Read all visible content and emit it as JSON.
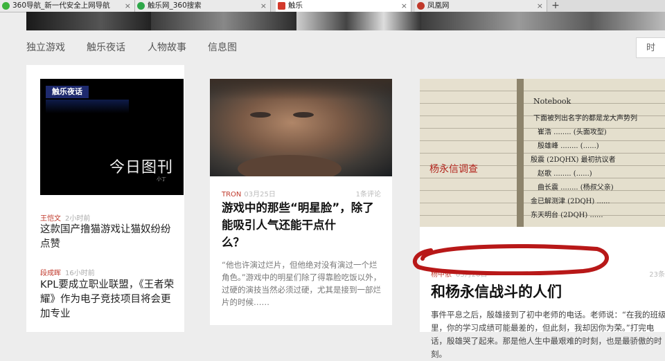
{
  "tabs": [
    {
      "label": "360导航_新一代安全上网导航",
      "icon_color": "#3db33d"
    },
    {
      "label": "触乐网_360搜索",
      "icon_color": "#2fa84a"
    },
    {
      "label": "触乐",
      "icon_color": "#d33a2c"
    },
    {
      "label": "凤凰网",
      "icon_color": "#c0392b"
    }
  ],
  "nav": {
    "items": [
      "独立游戏",
      "触乐夜话",
      "人物故事",
      "信息图"
    ],
    "search_label": "时"
  },
  "left_column": {
    "thumb_badge": "触乐夜话",
    "thumb_script": "今日图刊",
    "thumb_small": "小丁",
    "items": [
      {
        "author": "王恺文",
        "time": "2小时前",
        "title": "这款国产撸猫游戏让猫奴纷纷点赞"
      },
      {
        "author": "段成晖",
        "time": "16小时前",
        "title": "KPL要成立职业联盟，《王者荣耀》作为电子竞技项目将会更加专业"
      }
    ]
  },
  "card_middle": {
    "tag": "TRON",
    "date": "03月25日",
    "comments": "1条评论",
    "title": "游戏中的那些“明星脸”，除了能吸引人气还能干点什",
    "title_cont": "么？",
    "desc": "“他也许演过烂片，但他绝对没有演过一个烂角色。”游戏中的明星们除了得靠脸吃饭以外，过硬的演技当然必须过硬，尤其是接到一部烂片的时候……"
  },
  "card_right": {
    "notebook_label": "Notebook",
    "red_note": "杨永信调查",
    "author": "杨中依",
    "date": "03月20日",
    "comments": "23条",
    "title": "和杨永信战斗的人们",
    "desc": "事件平息之后，殷雄接到了初中老师的电话。老师说：“在我的班级里，你的学习成绩可能最差的，但此刻，我却因你为荣。”打完电话，殷雄哭了起来。那是他人生中最艰难的时刻，也是最骄傲的时刻。"
  }
}
